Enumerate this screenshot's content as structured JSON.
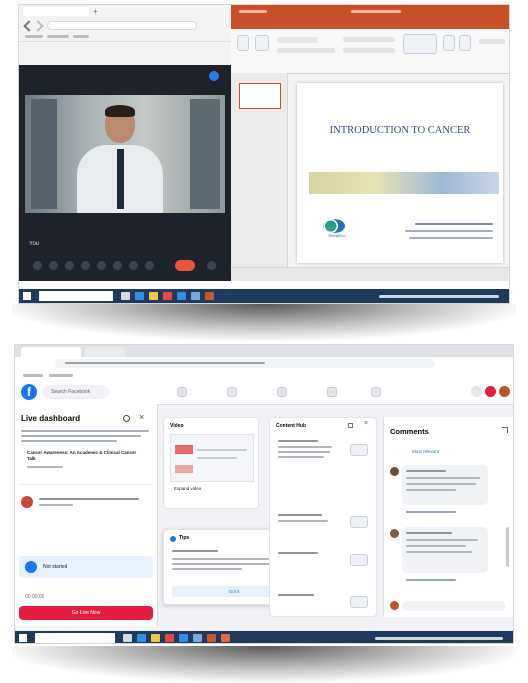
{
  "top_screen": {
    "meeting_window": {
      "participant_label": "You"
    },
    "powerpoint": {
      "slide": {
        "title": "INTRODUCTION TO CANCER",
        "logo_text": "ReallyB3.0"
      }
    }
  },
  "bottom_screen": {
    "facebook": {
      "search": {
        "placeholder": "Search Facebook"
      },
      "left_panel": {
        "title": "Live dashboard",
        "video_title": "Cancer Awareness: An Academic & Clinical Cancer Talk",
        "status": "Not started",
        "timer": "00:00:00",
        "go_live_label": "Go Live Now"
      },
      "video_card": {
        "title": "Video",
        "expand_label": "Expand video"
      },
      "tips_card": {
        "title": "Tips",
        "action_label": "Got it"
      },
      "content_card": {
        "title": "Content Hub"
      },
      "comments": {
        "title": "Comments",
        "sort_label": "Most relevant"
      }
    }
  },
  "colors": {
    "taskbar": "#1f3a5c",
    "facebook_blue": "#1877f2",
    "go_live_red": "#e41e3f",
    "end_call_red": "#e8553b",
    "ppt_orange": "#c9512a",
    "slide_title": "#2f4a8f"
  }
}
